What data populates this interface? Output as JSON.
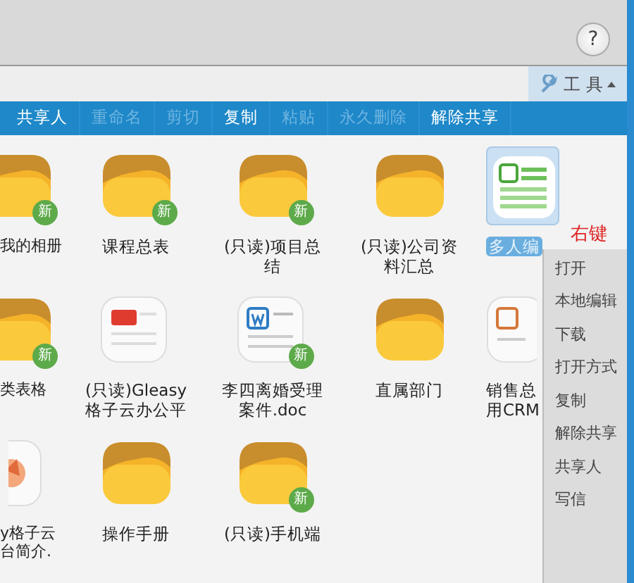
{
  "help_button": {
    "label": "?"
  },
  "tools_button": {
    "label": "工 具"
  },
  "toolbar": [
    {
      "label": "共享人",
      "disabled": false
    },
    {
      "label": "重命名",
      "disabled": true
    },
    {
      "label": "剪切",
      "disabled": true
    },
    {
      "label": "复制",
      "disabled": false
    },
    {
      "label": "粘贴",
      "disabled": true
    },
    {
      "label": "永久删除",
      "disabled": true
    },
    {
      "label": "解除共享",
      "disabled": false
    }
  ],
  "files": [
    {
      "label": "我的相册",
      "kind": "folder",
      "badge": "新",
      "selected": false
    },
    {
      "label": "课程总表",
      "kind": "folder",
      "badge": "新",
      "selected": false
    },
    {
      "label": "(只读)项目总结",
      "kind": "folder",
      "badge": "新",
      "selected": false
    },
    {
      "label": "(只读)公司资料汇总",
      "kind": "folder",
      "selected": false
    },
    {
      "label": "多人编",
      "kind": "sheet",
      "selected": true
    },
    {
      "label": "类表格",
      "kind": "folder",
      "badge": "新",
      "selected": false
    },
    {
      "label": "(只读)Gleasy格子云办公平",
      "kind": "pdf",
      "selected": false
    },
    {
      "label": "李四离婚受理案件.doc",
      "kind": "word",
      "badge": "新",
      "selected": false
    },
    {
      "label": "直属部门",
      "kind": "folder",
      "selected": false
    },
    {
      "label": "销售总用CRM",
      "kind": "ppt",
      "selected": false
    },
    {
      "label": "y格子云台简介.",
      "kind": "image",
      "selected": false
    },
    {
      "label": "操作手册",
      "kind": "folder",
      "selected": false
    },
    {
      "label": "(只读)手机端",
      "kind": "folder",
      "badge": "新",
      "selected": false
    }
  ],
  "annotation": "右键",
  "context_menu": [
    "打开",
    "本地编辑",
    "下载",
    "打开方式",
    "复制",
    "解除共享",
    "共享人",
    "写信"
  ]
}
